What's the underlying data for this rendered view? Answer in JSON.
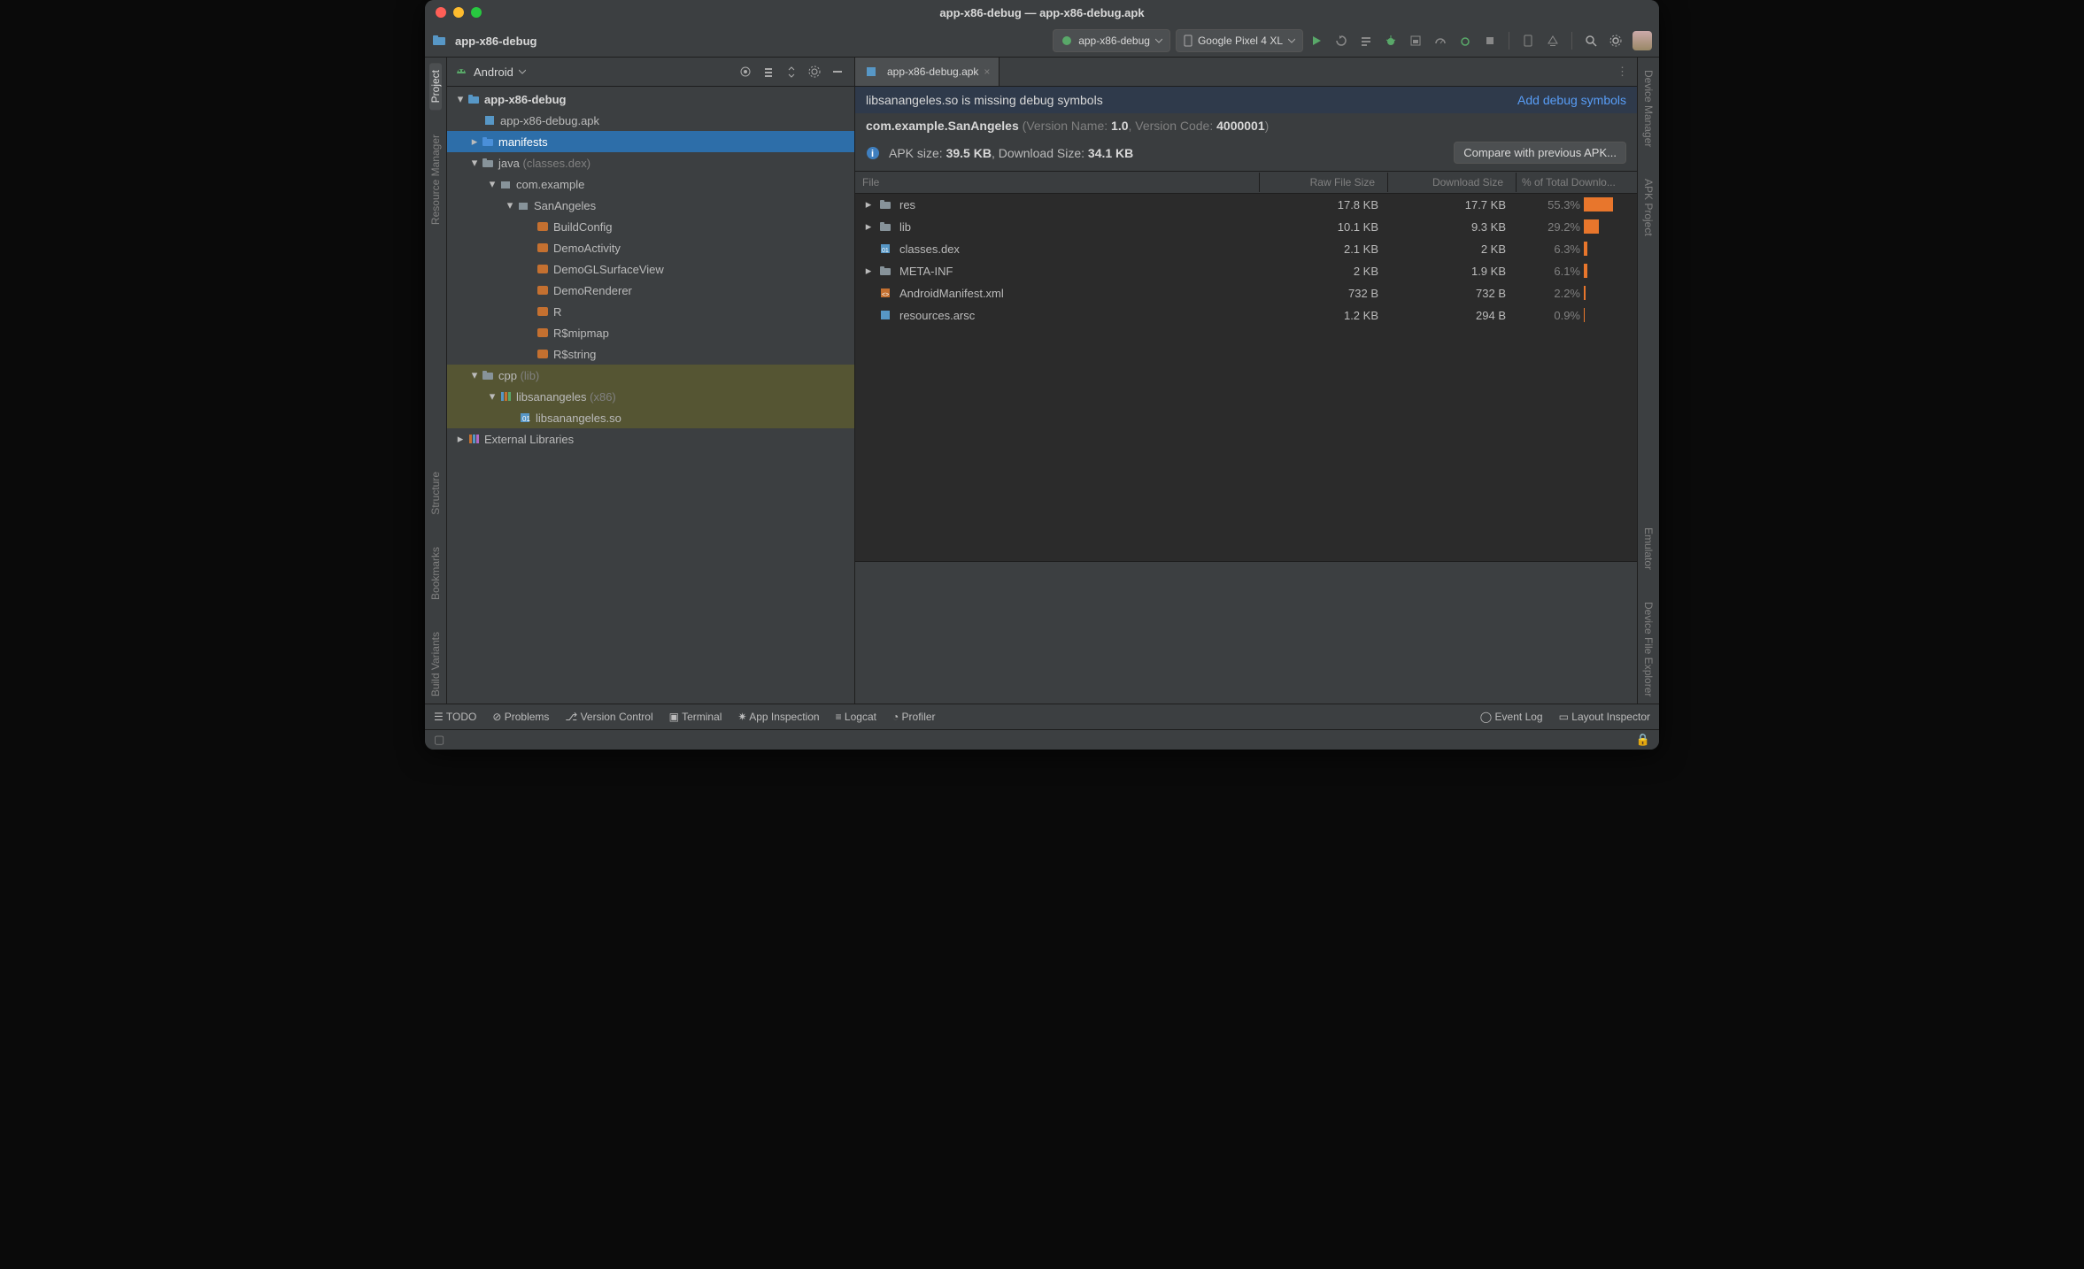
{
  "window": {
    "title": "app-x86-debug — app-x86-debug.apk"
  },
  "breadcrumb": {
    "root": "app-x86-debug"
  },
  "toolbar": {
    "run_config": "app-x86-debug",
    "device": "Google Pixel 4 XL"
  },
  "left_gutter": [
    "Project",
    "Resource Manager",
    "Structure",
    "Bookmarks",
    "Build Variants"
  ],
  "right_gutter": [
    "Device Manager",
    "APK Project",
    "Emulator",
    "Device File Explorer"
  ],
  "project_panel": {
    "mode": "Android"
  },
  "tree": {
    "root": "app-x86-debug",
    "apk": "app-x86-debug.apk",
    "manifests": "manifests",
    "java": "java",
    "java_hint": "(classes.dex)",
    "pkg1": "com.example",
    "pkg2": "SanAngeles",
    "cls1": "BuildConfig",
    "cls2": "DemoActivity",
    "cls3": "DemoGLSurfaceView",
    "cls4": "DemoRenderer",
    "cls5": "R",
    "cls6": "R$mipmap",
    "cls7": "R$string",
    "cpp": "cpp",
    "cpp_hint": "(lib)",
    "lib": "libsanangeles",
    "lib_hint": "(x86)",
    "so": "libsanangeles.so",
    "ext": "External Libraries"
  },
  "tab": {
    "name": "app-x86-debug.apk"
  },
  "banner": {
    "msg": "libsanangeles.so is missing debug symbols",
    "action": "Add debug symbols"
  },
  "meta": {
    "pkg": "com.example.SanAngeles",
    "vname_label": "Version Name:",
    "vname": "1.0",
    "vcode_label": "Version Code:",
    "vcode": "4000001"
  },
  "size": {
    "apk_label": "APK size:",
    "apk": "39.5 KB",
    "dl_label": "Download Size:",
    "dl": "34.1 KB",
    "compare": "Compare with previous APK..."
  },
  "table": {
    "headers": {
      "file": "File",
      "raw": "Raw File Size",
      "dl": "Download Size",
      "pct": "% of Total Downlo..."
    },
    "rows": [
      {
        "exp": true,
        "icon": "folder",
        "name": "res",
        "raw": "17.8 KB",
        "dl": "17.7 KB",
        "pct": "55.3%",
        "bar": 55
      },
      {
        "exp": true,
        "icon": "folder",
        "name": "lib",
        "raw": "10.1 KB",
        "dl": "9.3 KB",
        "pct": "29.2%",
        "bar": 29
      },
      {
        "exp": false,
        "icon": "dex",
        "name": "classes.dex",
        "raw": "2.1 KB",
        "dl": "2 KB",
        "pct": "6.3%",
        "bar": 6
      },
      {
        "exp": true,
        "icon": "folder",
        "name": "META-INF",
        "raw": "2 KB",
        "dl": "1.9 KB",
        "pct": "6.1%",
        "bar": 6
      },
      {
        "exp": false,
        "icon": "xml",
        "name": "AndroidManifest.xml",
        "raw": "732 B",
        "dl": "732 B",
        "pct": "2.2%",
        "bar": 3
      },
      {
        "exp": false,
        "icon": "arsc",
        "name": "resources.arsc",
        "raw": "1.2 KB",
        "dl": "294 B",
        "pct": "0.9%",
        "bar": 2
      }
    ]
  },
  "status": {
    "todo": "TODO",
    "problems": "Problems",
    "vcs": "Version Control",
    "terminal": "Terminal",
    "inspect": "App Inspection",
    "logcat": "Logcat",
    "profiler": "Profiler",
    "eventlog": "Event Log",
    "layout": "Layout Inspector"
  }
}
